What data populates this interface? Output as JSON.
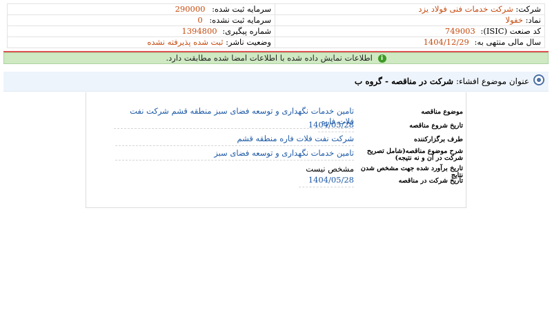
{
  "header": {
    "company_label": "شرکت:",
    "company_value": "شرکت خدمات فنی فولاد یزد",
    "registered_capital_label": "سرمایه ثبت شده:",
    "registered_capital_value": "290000",
    "symbol_label": "نماد:",
    "symbol_value": "خفولا",
    "unregistered_capital_label": "سرمایه ثبت نشده:",
    "unregistered_capital_value": "0",
    "isic_label": "کد صنعت (ISIC):",
    "isic_value": "749003",
    "tracking_label": "شماره پیگیری:",
    "tracking_value": "1394800",
    "fiscal_year_label": "سال مالی منتهی به:",
    "fiscal_year_value": "1404/12/29",
    "publisher_status_label": "وضعیت ناشر:",
    "publisher_status_value": "ثبت شده پذیرفته نشده"
  },
  "notice": {
    "text": "اطلاعات نمایش داده شده با اطلاعات امضا شده مطابقت دارد.",
    "icon": "info-icon",
    "icon_glyph": "i"
  },
  "subject": {
    "label": "عنوان موضوع افشاء:",
    "value": "شرکت در مناقصه - گروه ب"
  },
  "details": {
    "rows": [
      {
        "label": "موضوع مناقصه",
        "value": "تامین خدمات نگهداری و توسعه فضای سبز منطقه قشم شرکت نفت فلات فاره"
      },
      {
        "label": "تاریخ شروع مناقصه",
        "value": "1404/05/28"
      },
      {
        "label": "طرف برگزارکننده",
        "value": "شرکت نفت فلات فاره منطقه قشم"
      },
      {
        "label": "شرح موضوع مناقصه(شامل تصریح شرکت در آن و نه نتیجه)",
        "value": "تامین خدمات نگهداری و توسعه فضای سبز"
      },
      {
        "label": "تاریخ برآورد شده جهت مشخص شدن نتایج",
        "value": "مشخص نیست"
      },
      {
        "label": "تاریخ شرکت در مناقصه",
        "value": "1404/05/28"
      }
    ]
  },
  "colors": {
    "accent_orange": "#c44a0e",
    "link_blue": "#1e5aa6",
    "notice_green": "#cfe9c3",
    "divider_red": "#e05252"
  }
}
